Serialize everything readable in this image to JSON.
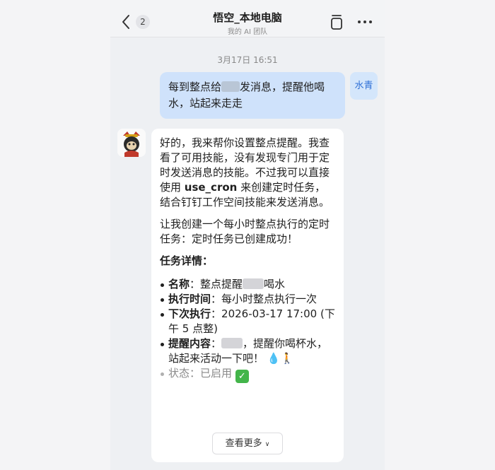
{
  "header": {
    "back_badge": "2",
    "title": "悟空_本地电脑",
    "subtitle": "我的 AI 团队"
  },
  "icons": {
    "back": "chevron-left-icon",
    "cup": "cup-icon",
    "more": "more-horizontal-icon",
    "water": "droplet-emoji",
    "walk": "walking-person-emoji",
    "check": "check-mark-emoji"
  },
  "chat": {
    "timestamp": "3月17日 16:51",
    "user_message": {
      "part1": "每到整点给",
      "part2": "发消息，提醒他喝水，站起来走走",
      "avatar_label": "水青"
    },
    "bot_message": {
      "para1_a": "好的，我来帮你设置整点提醒。我查看了可用技能，没有发现专门用于定时发送消息的技能。不过我可以直接使用 ",
      "para1_code": "use_cron",
      "para1_b": " 来创建定时任务，结合钉钉工作空间技能来发送消息。",
      "para2": "让我创建一个每小时整点执行的定时任务：定时任务已创建成功！",
      "details_heading": "任务详情：",
      "details": [
        {
          "label": "名称",
          "sep": "：",
          "value_a": "整点提醒",
          "value_b": "喝水"
        },
        {
          "label": "执行时间",
          "sep": "：",
          "value": "每小时整点执行一次"
        },
        {
          "label": "下次执行",
          "sep": "：",
          "value": "2026-03-17 17:00 (下午 5 点整)"
        },
        {
          "label": "提醒内容",
          "sep": "：",
          "value": "，提醒你喝杯水，站起来活动一下吧！"
        },
        {
          "label": "状态",
          "sep": "：",
          "value": "已启用"
        }
      ],
      "see_more": "查看更多"
    }
  },
  "colors": {
    "user_bubble": "#cfe2fb",
    "bot_bubble": "#ffffff",
    "background": "#eef0f3",
    "status_check": "#43b54a"
  }
}
